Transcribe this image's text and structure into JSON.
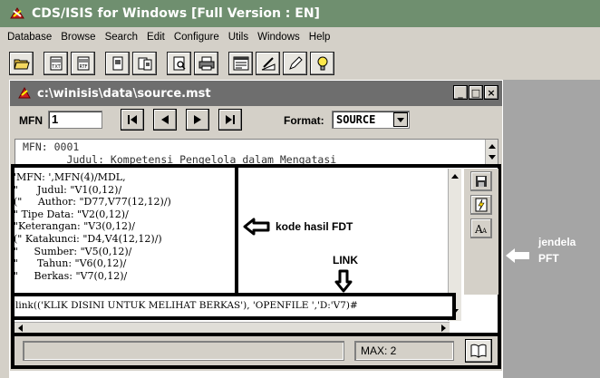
{
  "app": {
    "title": "CDS/ISIS for Windows [Full Version : EN]",
    "menu": [
      "Database",
      "Browse",
      "Search",
      "Edit",
      "Configure",
      "Utils",
      "Windows",
      "Help"
    ],
    "toolbar_icons": [
      "open-folder-icon",
      "txt-icon",
      "rtf-icon",
      "copy-record-icon",
      "paste-record-icon",
      "print-preview-icon",
      "printer-icon",
      "form-icon",
      "edit-icon",
      "pencil-icon",
      "lightbulb-icon"
    ]
  },
  "child_window": {
    "title": "c:\\winisis\\data\\source.mst",
    "buttons": {
      "minimize": "_",
      "maximize": "□",
      "close": "×"
    },
    "mfn_label": "MFN",
    "mfn_value": "1",
    "format_label": "Format:",
    "format_value": "SOURCE",
    "display_lines": [
      "MFN: 0001",
      "       Judul: Kompetensi Pengelola dalam Mengatasi"
    ],
    "pft_lines": [
      "'MFN: ',MFN(4)/MDL,",
      "\"      Judul: \"V1(0,12)/",
      "(\"     Author: \"D77,V77(12,12)/)",
      "\" Tipe Data: \"V2(0,12)/",
      "\"Keterangan: \"V3(0,12)/",
      "(\" Katakunci: \"D4,V4(12,12)/)",
      "\"     Sumber: \"V5(0,12)/",
      "\"      Tahun: \"V6(0,12)/",
      "\"     Berkas: \"V7(0,12)/"
    ],
    "link_line": "link(('KLIK DISINI UNTUK MELIHAT BERKAS'), 'OPENFILE ','D:'V7)#",
    "max_label": "MAX: 2"
  },
  "annotations": {
    "kode": "kode hasil FDT",
    "link": "LINK",
    "jendela_line1": "jendela",
    "jendela_line2": "PFT"
  }
}
